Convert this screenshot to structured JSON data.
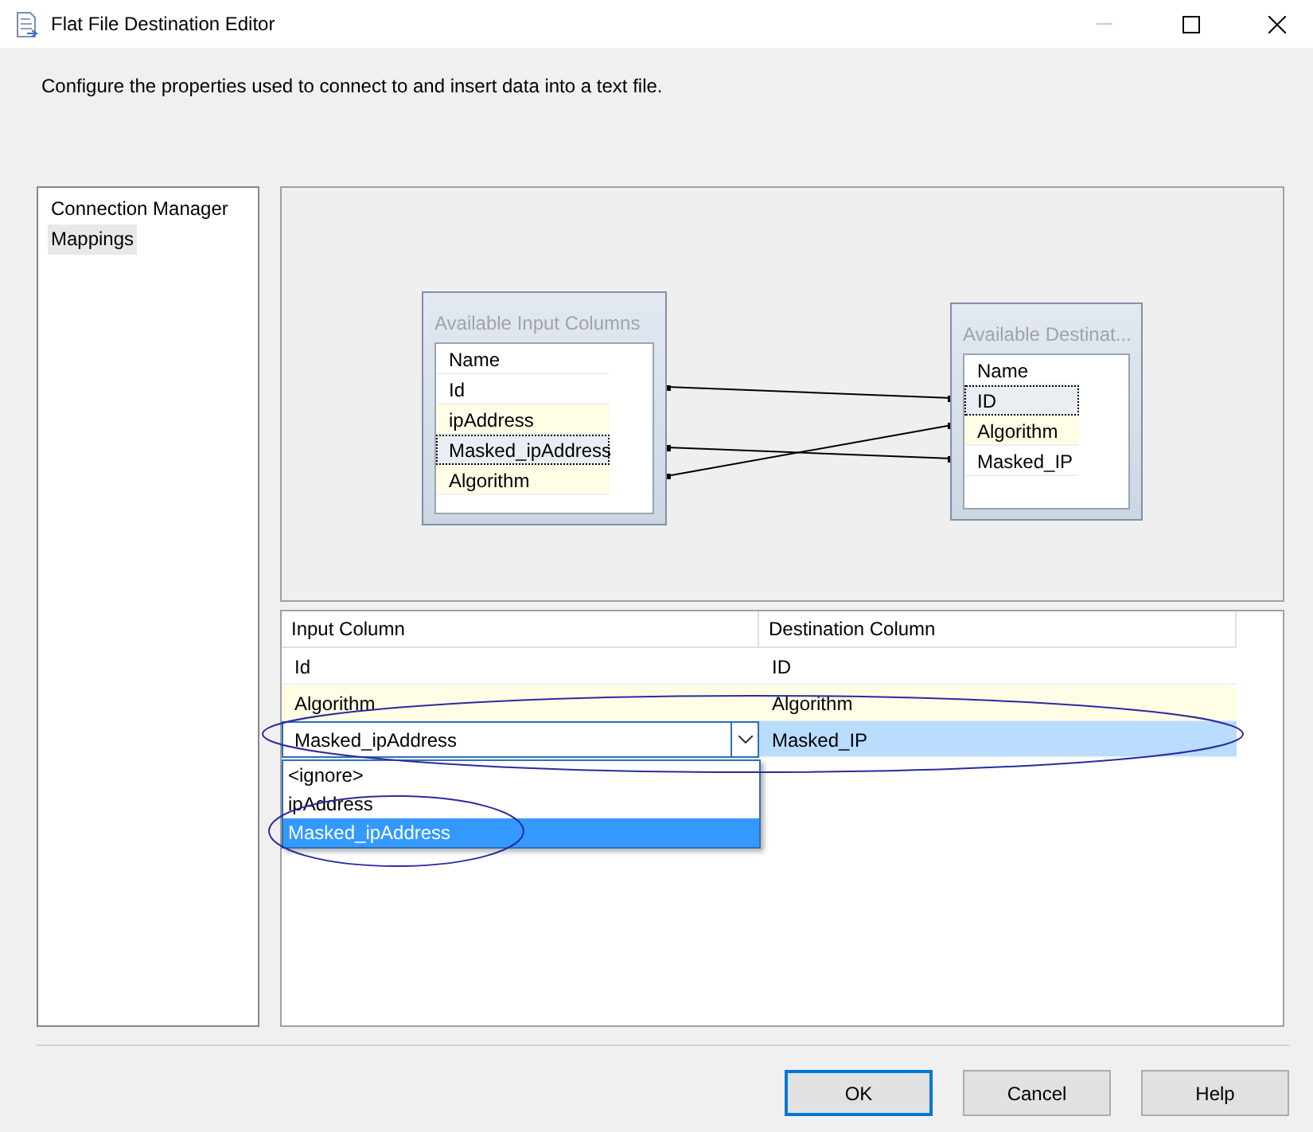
{
  "window": {
    "title": "Flat File Destination Editor"
  },
  "description": "Configure the properties used to connect to and insert data into a text file.",
  "sidebar": {
    "items": [
      {
        "label": "Connection Manager",
        "selected": false
      },
      {
        "label": "Mappings",
        "selected": true
      }
    ]
  },
  "diagram": {
    "input_node": {
      "title": "Available Input Columns",
      "header": "Name",
      "columns": [
        {
          "name": "Id",
          "focused": false
        },
        {
          "name": "ipAddress",
          "focused": false
        },
        {
          "name": "Masked_ipAddress",
          "focused": true
        },
        {
          "name": "Algorithm",
          "focused": false
        }
      ]
    },
    "destination_node": {
      "title": "Available Destinat...",
      "header": "Name",
      "columns": [
        {
          "name": "ID",
          "focused": true
        },
        {
          "name": "Algorithm",
          "focused": false
        },
        {
          "name": "Masked_IP",
          "focused": false
        }
      ]
    }
  },
  "grid": {
    "columns": [
      "Input Column",
      "Destination Column"
    ],
    "rows": [
      {
        "input": "Id",
        "destination": "ID",
        "editing": false
      },
      {
        "input": "Algorithm",
        "destination": "Algorithm",
        "editing": false
      },
      {
        "input": "Masked_ipAddress",
        "destination": "Masked_IP",
        "editing": true
      }
    ],
    "dropdown": {
      "options": [
        {
          "label": "<ignore>",
          "selected": false
        },
        {
          "label": "ipAddress",
          "selected": false
        },
        {
          "label": "Masked_ipAddress",
          "selected": true
        }
      ]
    }
  },
  "buttons": [
    {
      "label": "OK",
      "default": true
    },
    {
      "label": "Cancel",
      "default": false
    },
    {
      "label": "Help",
      "default": false
    }
  ]
}
